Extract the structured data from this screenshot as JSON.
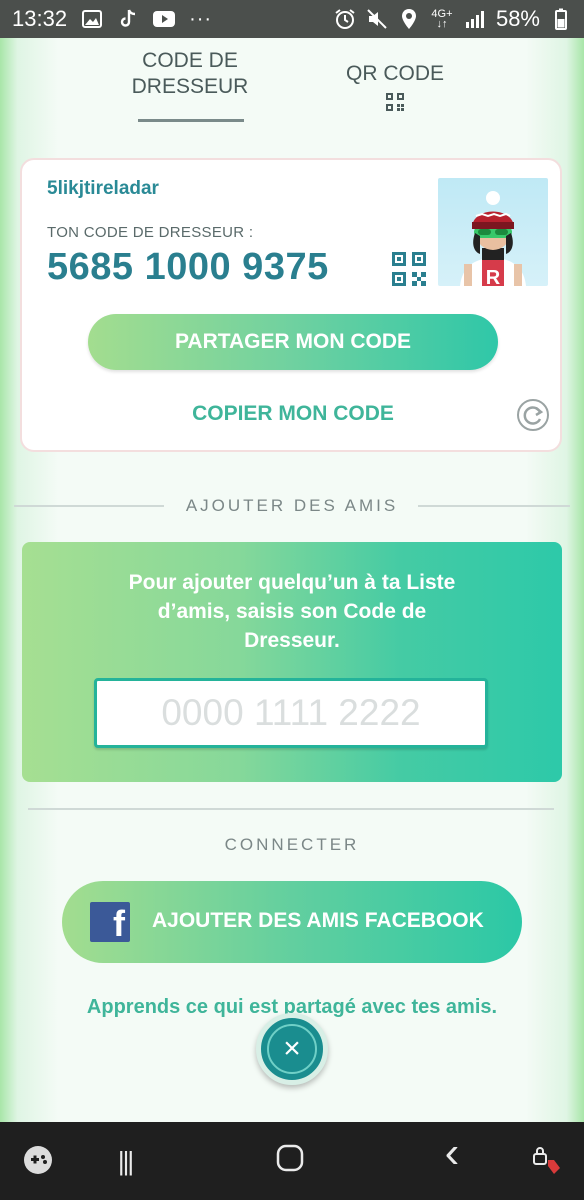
{
  "status_bar": {
    "time": "13:32",
    "left_icons": [
      "image-icon",
      "tiktok-icon",
      "youtube-icon",
      "more-icon"
    ],
    "more": "···",
    "network_top": "4G+",
    "network_bottom": "↓↑",
    "battery": "58%"
  },
  "tabs": {
    "trainer_code_line1": "CODE DE",
    "trainer_code_line2": "DRESSEUR",
    "qr_code": "QR CODE"
  },
  "card": {
    "username": "5likjtireladar",
    "code_label": "TON CODE DE DRESSEUR :",
    "code_value": "5685 1000 9375",
    "share_label": "PARTAGER MON CODE",
    "copy_label": "COPIER MON CODE"
  },
  "add_friends": {
    "section_title": "AJOUTER DES AMIS",
    "instructions_line1": "Pour ajouter quelqu’un à ta Liste",
    "instructions_line2": "d’amis, saisis son Code de",
    "instructions_line3": "Dresseur.",
    "input_placeholder": "0000 1111 2222",
    "input_value": ""
  },
  "connect": {
    "section_title": "CONNECTER",
    "facebook_label": "AJOUTER DES AMIS FACEBOOK",
    "facebook_glyph": "f",
    "learn_link": "Apprends ce qui est partagé avec tes amis."
  },
  "close": {
    "glyph": "×"
  },
  "nav_bar": {
    "items": [
      "game-launcher-icon",
      "recents-icon",
      "home-icon",
      "back-icon",
      "assistant-icon"
    ],
    "recents_glyph": "|||",
    "back_glyph": "‹"
  },
  "colors": {
    "accent_teal": "#2a7f8f",
    "accent_green": "#3fb59a",
    "facebook_blue": "#3b5998",
    "nav_bg": "#1f1f1f",
    "status_bg": "#4b4f4c"
  }
}
